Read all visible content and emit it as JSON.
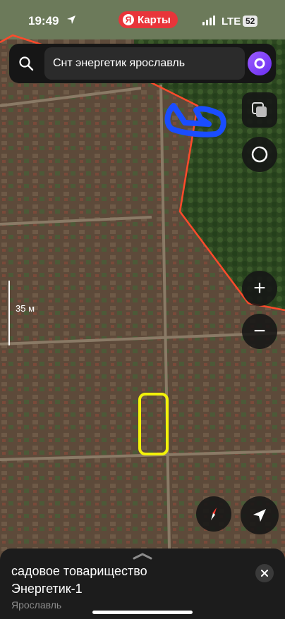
{
  "status_bar": {
    "time": "19:49",
    "location_icon": "location-arrow-icon",
    "app_link_label": "Карты",
    "network": "LTE",
    "battery": "52"
  },
  "search": {
    "query": "Снт энергетик ярославль",
    "icon": "search-icon",
    "assistant_icon": "alice-assistant-icon"
  },
  "map": {
    "view": "satellite",
    "scale_label": "35 м",
    "colors": {
      "boundary": "#ff4a2b",
      "blue_marker": "#1a4dff",
      "yellow_marker": "#f2f20a",
      "forest": "#2f4a22",
      "ground": "#5a4a3a"
    }
  },
  "controls": {
    "layers_icon": "layers-icon",
    "routes_icon": "circle-icon",
    "zoom_in_label": "+",
    "zoom_out_label": "−",
    "compass_icon": "compass-icon",
    "my_location_icon": "navigation-arrow-icon"
  },
  "place_card": {
    "type": "садовое товарищество",
    "name": "Энергетик-1",
    "city": "Ярославль",
    "close_icon": "close-icon"
  }
}
